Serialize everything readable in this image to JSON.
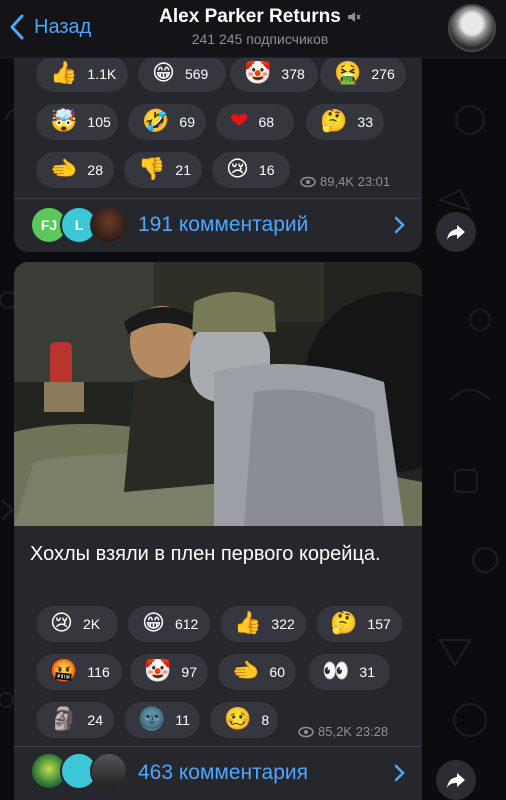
{
  "header": {
    "back_label": "Назад",
    "channel_name": "Alex Parker Returns",
    "subscribers": "241 245 подписчиков"
  },
  "post1": {
    "reactions": [
      {
        "emoji": "👍",
        "count": "1.1K"
      },
      {
        "emoji": "😁",
        "count": "569"
      },
      {
        "emoji": "🤡",
        "count": "378"
      },
      {
        "emoji": "🤮",
        "count": "276"
      },
      {
        "emoji": "🤯",
        "count": "105"
      },
      {
        "emoji": "🤣",
        "count": "69"
      },
      {
        "emoji": "❤",
        "count": "68"
      },
      {
        "emoji": "🤔",
        "count": "33"
      },
      {
        "emoji": "🫲",
        "count": "28"
      },
      {
        "emoji": "👎",
        "count": "21"
      },
      {
        "emoji": "😢",
        "count": "16"
      }
    ],
    "views_time": "89,4K 23:01",
    "avatar_initials": [
      "FJ",
      "L"
    ],
    "comments": "191 комментарий"
  },
  "post2": {
    "caption": "Хохлы взяли в плен первого корейца.",
    "reactions": [
      {
        "emoji": "😢",
        "count": "2K"
      },
      {
        "emoji": "😁",
        "count": "612"
      },
      {
        "emoji": "👍",
        "count": "322"
      },
      {
        "emoji": "🤔",
        "count": "157"
      },
      {
        "emoji": "🤬",
        "count": "116"
      },
      {
        "emoji": "🤡",
        "count": "97"
      },
      {
        "emoji": "🫲",
        "count": "60"
      },
      {
        "emoji": "👀",
        "count": "31"
      },
      {
        "emoji": "🗿",
        "count": "24"
      },
      {
        "emoji": "🌚",
        "count": "11"
      },
      {
        "emoji": "🥴",
        "count": "8"
      }
    ],
    "views_time": "85,2K 23:28",
    "comments": "463 комментария"
  },
  "colors": {
    "accent": "#4ea6ff",
    "bubble": "#26262d",
    "chip": "#36363f",
    "background": "#0c0c10"
  },
  "icons": {
    "back": "chevron-left-icon",
    "mute": "muted-speaker-icon",
    "views": "eye-icon",
    "share": "share-arrow-icon",
    "chevron": "chevron-right-icon"
  }
}
